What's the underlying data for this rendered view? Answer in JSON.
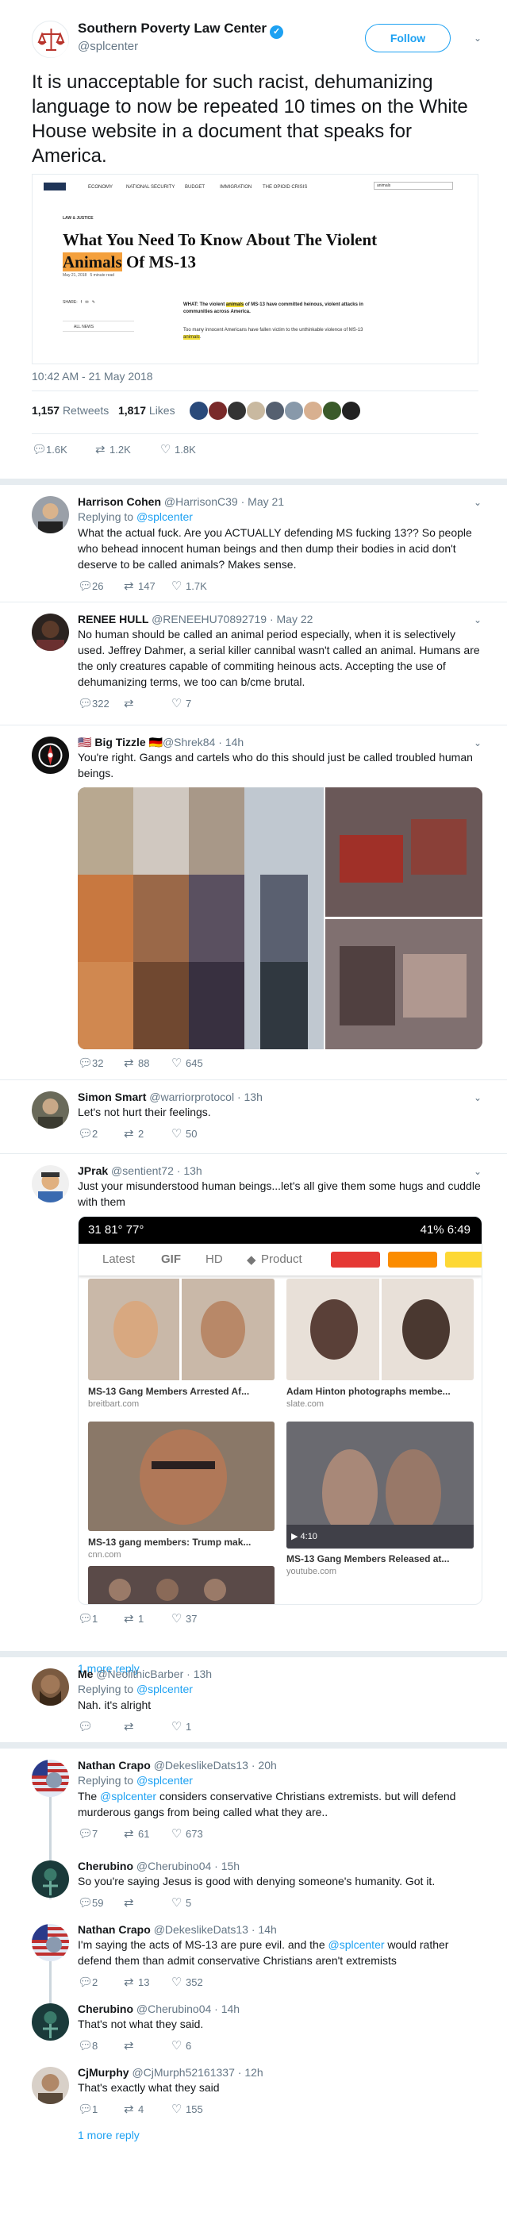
{
  "main": {
    "name": "Southern Poverty Law Center",
    "handle": "@splcenter",
    "follow_label": "Follow",
    "text": "It is unacceptable for such racist, dehumanizing language to now be repeated 10 times on the White House website in a document that speaks for America.",
    "embed": {
      "nav": [
        "ECONOMY",
        "NATIONAL SECURITY",
        "BUDGET",
        "IMMIGRATION",
        "THE OPIOID CRISIS"
      ],
      "search_value": "animals",
      "kicker": "LAW & JUSTICE",
      "title_before": "What You Need To Know About The Violent",
      "title_highlight": "Animals",
      "title_after": "Of MS-13",
      "date": "May 21, 2018",
      "read_time": "5 minute read",
      "share_label": "SHARE:",
      "all_news": "ALL NEWS",
      "what_prefix": "WHAT: The violent",
      "what_highlight": "animals",
      "what_suffix": "of MS-13 have committed heinous, violent attacks in communities across America.",
      "body_text": "Too many innocent Americans have fallen victim to the unthinkable violence of MS-13",
      "body_highlight": "animals"
    },
    "timestamp": "10:42 AM - 21 May 2018",
    "retweets_count": "1,157",
    "retweets_label": "Retweets",
    "likes_count": "1,817",
    "likes_label": "Likes",
    "actions": {
      "replies": "1.6K",
      "retweets": "1.2K",
      "likes": "1.8K"
    }
  },
  "replies": [
    {
      "name": "Harrison Cohen",
      "handle": "@HarrisonC39",
      "time": "May 21",
      "replying_label": "Replying to",
      "replying_to": "@splcenter",
      "text": "What the actual fuck. Are you ACTUALLY defending MS fucking 13?? So people who behead innocent human beings and then dump their bodies in acid don't deserve to be called animals? Makes sense.",
      "replies": "26",
      "retweets": "147",
      "likes": "1.7K"
    },
    {
      "name": "RENEE HULL",
      "handle": "@RENEEHU70892719",
      "time": "May 22",
      "text": "No human should be called an animal period especially, when it is selectively used. Jeffrey Dahmer, a serial killer cannibal wasn't called an animal. Humans are the only creatures capable of commiting heinous acts. Accepting the use of dehumanizing terms, we too can b/cme brutal.",
      "replies": "322",
      "retweets": "",
      "likes": "7"
    },
    {
      "name": "Big Tizzle",
      "handle": "@Shrek84",
      "time": "14h",
      "text": "You're right. Gangs and cartels who do this should just be called troubled human beings.",
      "replies": "32",
      "retweets": "88",
      "likes": "645"
    },
    {
      "name": "Simon Smart",
      "handle": "@warriorprotocol",
      "time": "13h",
      "text": "Let's not hurt their feelings.",
      "replies": "2",
      "retweets": "2",
      "likes": "50"
    },
    {
      "name": "JPrak",
      "handle": "@sentient72",
      "time": "13h",
      "text": "Just your misunderstood human beings...let's all give them some hugs and cuddle with them",
      "phone": {
        "status_left": "31  81°  77°",
        "status_right": "41%  6:49",
        "tabs": [
          "Latest",
          "GIF",
          "HD",
          "Product"
        ],
        "cards": [
          {
            "caption": "MS-13 Gang Members Arrested Af...",
            "source": "breitbart.com"
          },
          {
            "caption": "Adam Hinton photographs membe...",
            "source": "slate.com"
          },
          {
            "caption": "MS-13 gang members: Trump mak...",
            "source": "cnn.com"
          },
          {
            "caption": "MS-13 Gang Members Released at...",
            "source": "youtube.com",
            "duration": "4:10"
          }
        ]
      },
      "replies": "1",
      "retweets": "1",
      "likes": "37",
      "more_replies": "1 more reply"
    },
    {
      "name": "Me",
      "handle": "@NeolithicBarber",
      "time": "13h",
      "replying_label": "Replying to",
      "replying_to": "@splcenter",
      "text": "Nah. it's alright",
      "replies": "",
      "retweets": "",
      "likes": "1"
    },
    {
      "name": "Nathan Crapo",
      "handle": "@DekeslikeDats13",
      "time": "20h",
      "replying_label": "Replying to",
      "replying_to": "@splcenter",
      "text_mention": "@splcenter",
      "text_prefix": "The",
      "text": "considers conservative Christians extremists. but will defend murderous gangs from being called what they are..",
      "replies": "7",
      "retweets": "61",
      "likes": "673"
    },
    {
      "name": "Cherubino",
      "handle": "@Cherubino04",
      "time": "15h",
      "text": "So you're saying Jesus is good with denying someone's humanity. Got it.",
      "replies": "59",
      "retweets": "",
      "likes": "5"
    },
    {
      "name": "Nathan Crapo",
      "handle": "@DekeslikeDats13",
      "time": "14h",
      "text_prefix": "I'm saying the acts of MS-13 are pure evil. and the",
      "text_mention": "@splcenter",
      "text": "would rather defend them than admit conservative Christians aren't extremists",
      "replies": "2",
      "retweets": "13",
      "likes": "352"
    },
    {
      "name": "Cherubino",
      "handle": "@Cherubino04",
      "time": "14h",
      "text": "That's not what they said.",
      "replies": "8",
      "retweets": "",
      "likes": "6"
    },
    {
      "name": "CjMurphy",
      "handle": "@CjMurph52161337",
      "time": "12h",
      "text": "That's exactly what they said",
      "replies": "1",
      "retweets": "4",
      "likes": "155",
      "more_replies": "1 more reply"
    }
  ],
  "icons": {
    "reply": "reply-icon",
    "retweet": "retweet-icon",
    "like": "heart-icon",
    "chevron": "chevron-down-icon",
    "verified": "verified-badge-icon"
  },
  "colors": {
    "accent": "#1da1f2",
    "muted": "#657786",
    "border": "#e6ecf0",
    "logo_red": "#b8342c"
  }
}
